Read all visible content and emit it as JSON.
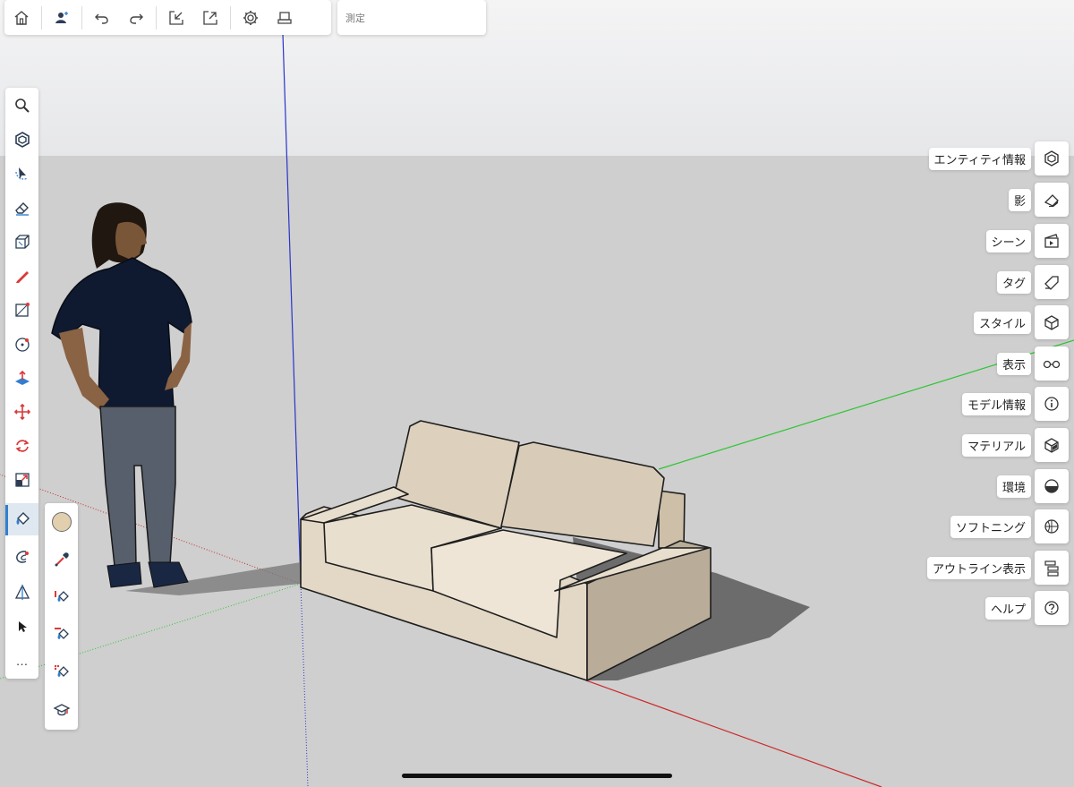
{
  "top_toolbar": {
    "buttons": [
      "home-icon",
      "add-user-icon",
      "undo-icon",
      "redo-icon",
      "import-icon",
      "export-icon",
      "settings-icon",
      "print-icon"
    ]
  },
  "measure": {
    "label": "測定"
  },
  "left_toolbar": {
    "tools": [
      "search-icon",
      "select-icon",
      "orbit-icon",
      "eraser-icon",
      "box-icon",
      "pencil-icon",
      "rectangle-icon",
      "circle-icon",
      "push-pull-icon",
      "move-icon",
      "rotate-icon",
      "scale-icon",
      "paint-bucket-icon",
      "offset-icon",
      "section-icon",
      "pointer-icon",
      "more-icon"
    ],
    "more_label": "…",
    "active_tool": "paint-bucket-icon"
  },
  "paint_flyout": {
    "current_color": "#e2cfae",
    "tools": [
      "eyedropper-icon",
      "paint-replace-icon",
      "paint-adjacent-icon",
      "paint-object-icon",
      "tutorial-icon"
    ]
  },
  "right_panel": {
    "items": [
      {
        "label": "エンティティ情報",
        "icon": "entity-info-icon"
      },
      {
        "label": "影",
        "icon": "shadow-icon"
      },
      {
        "label": "シーン",
        "icon": "scenes-icon"
      },
      {
        "label": "タグ",
        "icon": "tag-icon"
      },
      {
        "label": "スタイル",
        "icon": "styles-icon"
      },
      {
        "label": "表示",
        "icon": "display-icon"
      },
      {
        "label": "モデル情報",
        "icon": "model-info-icon"
      },
      {
        "label": "マテリアル",
        "icon": "materials-icon"
      },
      {
        "label": "環境",
        "icon": "environment-icon"
      },
      {
        "label": "ソフトニング",
        "icon": "softening-icon"
      },
      {
        "label": "アウトライン表示",
        "icon": "outliner-icon"
      },
      {
        "label": "ヘルプ",
        "icon": "help-icon"
      }
    ]
  },
  "colors": {
    "sky": "#eaebed",
    "ground": "#cfcfcf",
    "axis_blue": "#2a34c8",
    "axis_green": "#2ec433",
    "axis_red": "#cc2a2a",
    "sofa_fabric": "#e2d6c3",
    "accent": "#2f7fd1"
  }
}
